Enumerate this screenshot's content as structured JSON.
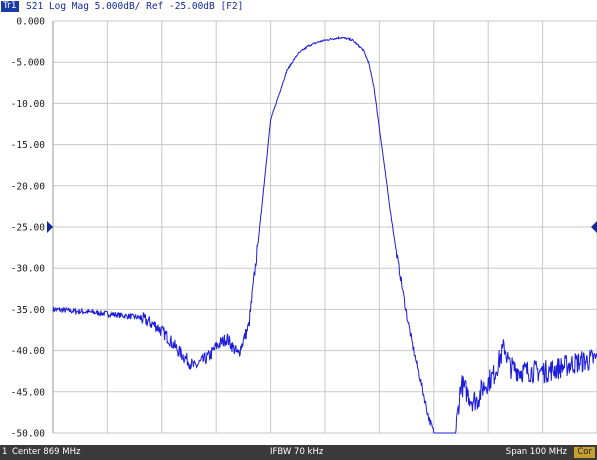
{
  "trace": {
    "tag": "Tr1",
    "title": "S21 Log Mag 5.000dB/ Ref -25.00dB [F2]",
    "color": "#1c1cdc"
  },
  "y_axis": {
    "labels": [
      "0.000",
      "-5.000",
      "-10.00",
      "-15.00",
      "-20.00",
      "-25.00",
      "-30.00",
      "-35.00",
      "-40.00",
      "-45.00",
      "-50.00"
    ],
    "ref_label_color": "#1428a0"
  },
  "status": {
    "channel": "1",
    "center": "Center 869 MHz",
    "ifbw": "IFBW 70 kHz",
    "span": "Span 100 MHz",
    "cor": "Cor"
  },
  "chart_data": {
    "type": "line",
    "xlabel": "",
    "ylabel": "",
    "xlim": [
      819,
      919
    ],
    "ylim": [
      -50,
      0
    ],
    "grid": true,
    "series": [
      {
        "x": [
          819,
          825,
          830,
          835,
          838,
          840,
          842,
          845,
          846,
          848,
          849,
          851,
          852,
          853,
          855,
          857,
          859,
          862,
          864,
          866,
          868,
          870,
          872,
          874,
          876,
          877,
          878,
          879,
          880,
          881,
          882,
          883,
          884,
          885,
          886,
          887,
          888,
          889,
          890,
          891,
          892,
          893,
          894,
          895,
          896,
          897,
          898,
          900,
          902,
          903,
          905,
          910,
          915,
          919
        ],
        "y": [
          -35.0,
          -35.3,
          -35.6,
          -36.0,
          -37.0,
          -38.3,
          -40.0,
          -42.0,
          -41.5,
          -40.5,
          -39.5,
          -38.5,
          -39.5,
          -40.5,
          -37.0,
          -25.0,
          -12.0,
          -6.0,
          -4.0,
          -3.0,
          -2.5,
          -2.2,
          -2.0,
          -2.3,
          -3.5,
          -5.0,
          -8.0,
          -13.0,
          -18.0,
          -23.0,
          -27.5,
          -31.5,
          -35.5,
          -39.0,
          -42.0,
          -45.0,
          -48.0,
          -50.0,
          -50.0,
          -50.0,
          -50.0,
          -50.0,
          -44.0,
          -45.0,
          -46.0,
          -46.0,
          -44.5,
          -43.0,
          -39.5,
          -42.0,
          -42.5,
          -42.5,
          -41.5,
          -41.0
        ]
      }
    ]
  }
}
